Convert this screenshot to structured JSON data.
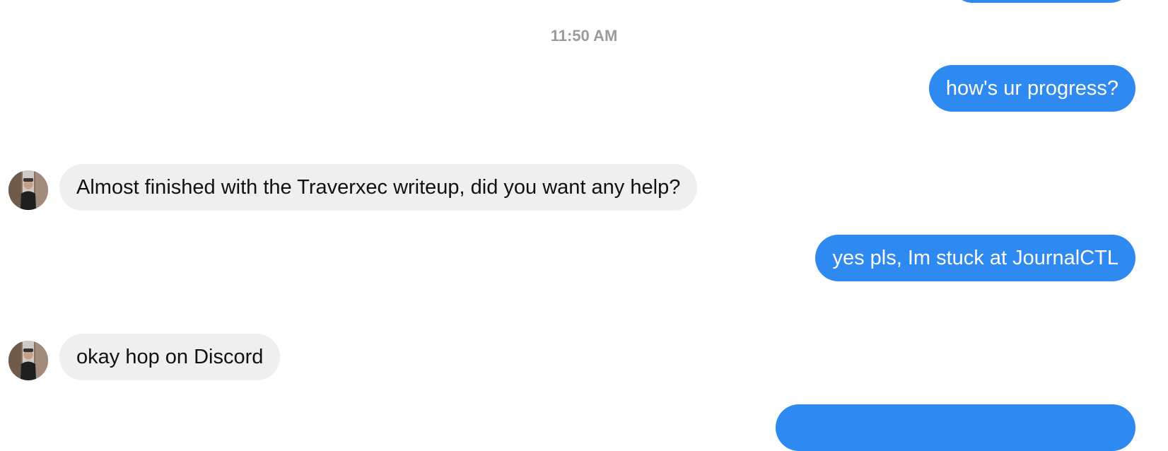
{
  "timestamp": "11:50 AM",
  "messages": [
    {
      "direction": "outgoing",
      "text": "how's ur progress?"
    },
    {
      "direction": "incoming",
      "text": "Almost finished with the Traverxec writeup, did you want any help?"
    },
    {
      "direction": "outgoing",
      "text": "yes pls, Im stuck at JournalCTL"
    },
    {
      "direction": "incoming",
      "text": "okay hop on Discord"
    }
  ],
  "colors": {
    "outgoing_bubble": "#2e89f0",
    "incoming_bubble": "#efefef",
    "timestamp_text": "#9b9b9b"
  },
  "icons": {
    "contact_avatar": "person-photo-avatar"
  }
}
